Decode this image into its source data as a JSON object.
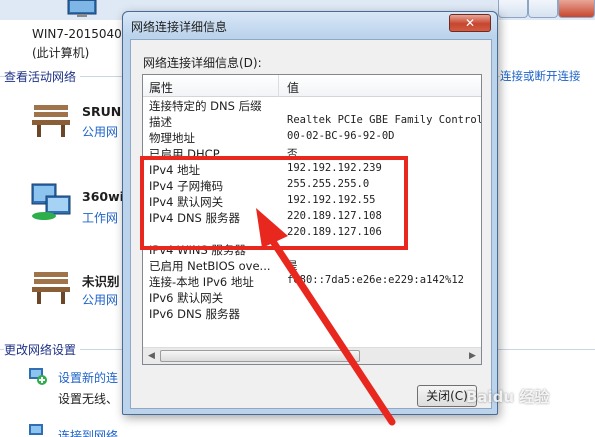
{
  "background": {
    "computer_name": "WIN7-2015040",
    "computer_sub": "(此计算机)",
    "active_networks_title": "查看活动网络",
    "networks": [
      {
        "name": "SRUN",
        "type": "公用网"
      },
      {
        "name": "360wi",
        "type": "工作网"
      },
      {
        "name": "未识别",
        "type": "公用网"
      }
    ],
    "connect_disconnect_link": "连接或断开连接",
    "change_settings_title": "更改网络设置",
    "tasks": [
      {
        "link": "设置新的连",
        "desc": "设置无线、"
      },
      {
        "link": "连接到网络",
        "desc": ""
      }
    ]
  },
  "dialog": {
    "title": "网络连接详细信息",
    "close_glyph": "✕",
    "details_label": "网络连接详细信息(D):",
    "columns": {
      "property": "属性",
      "value": "值"
    },
    "rows": [
      {
        "property": "连接特定的 DNS 后缀",
        "value": ""
      },
      {
        "property": "描述",
        "value": "Realtek PCIe GBE Family Controlle"
      },
      {
        "property": "物理地址",
        "value": "00-02-BC-96-92-0D"
      },
      {
        "property": "已启用 DHCP",
        "value": "否"
      },
      {
        "property": "IPv4 地址",
        "value": "192.192.192.239"
      },
      {
        "property": "IPv4 子网掩码",
        "value": "255.255.255.0"
      },
      {
        "property": "IPv4 默认网关",
        "value": "192.192.192.55"
      },
      {
        "property": "IPv4 DNS 服务器",
        "value": "220.189.127.108"
      },
      {
        "property": "",
        "value": "220.189.127.106"
      },
      {
        "property": "IPv4 WINS 服务器",
        "value": ""
      },
      {
        "property": "已启用 NetBIOS ove...",
        "value": "是"
      },
      {
        "property": "连接-本地 IPv6 地址",
        "value": "fe80::7da5:e26e:e229:a142%12"
      },
      {
        "property": "IPv6 默认网关",
        "value": ""
      },
      {
        "property": "IPv6 DNS 服务器",
        "value": ""
      }
    ],
    "scroll_left": "◀",
    "scroll_right": "▶",
    "close_button": "关闭(C)"
  },
  "watermark": "Baidu 经验",
  "colors": {
    "highlight": "#e8271e",
    "link": "#1e64c8",
    "dialog_frame": "#bcd3ec"
  }
}
